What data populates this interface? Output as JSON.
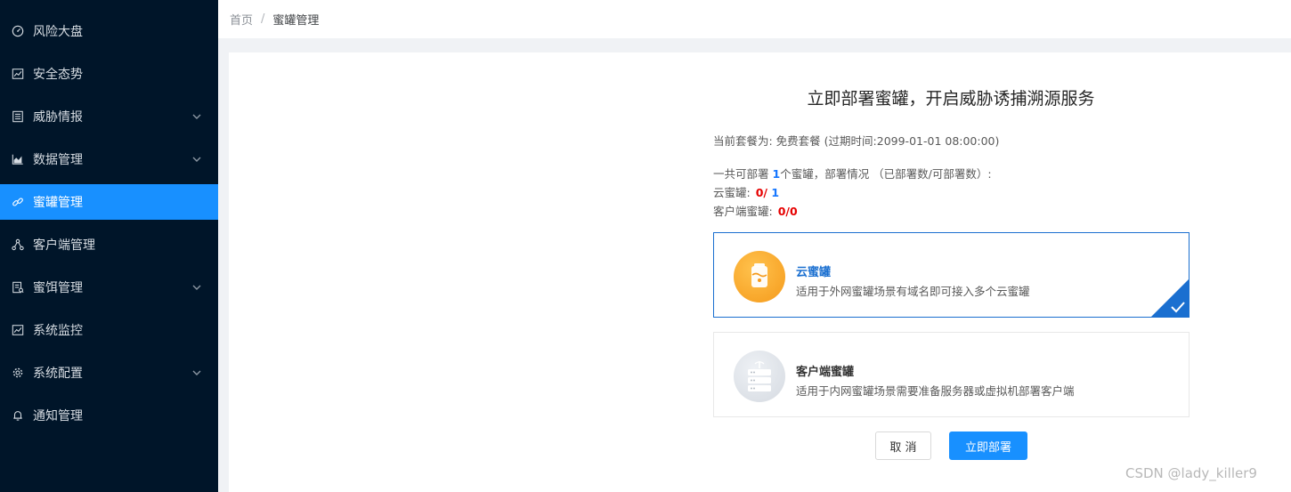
{
  "sidebar": {
    "items": [
      {
        "label": "风险大盘",
        "icon": "dashboard-icon"
      },
      {
        "label": "安全态势",
        "icon": "line-chart-icon"
      },
      {
        "label": "威胁情报",
        "icon": "list-icon",
        "has_submenu": true
      },
      {
        "label": "数据管理",
        "icon": "area-chart-icon",
        "has_submenu": true
      },
      {
        "label": "蜜罐管理",
        "icon": "link-icon",
        "active": true
      },
      {
        "label": "客户端管理",
        "icon": "nodes-icon"
      },
      {
        "label": "蜜饵管理",
        "icon": "file-list-icon",
        "has_submenu": true
      },
      {
        "label": "系统监控",
        "icon": "line-chart-icon"
      },
      {
        "label": "系统配置",
        "icon": "gear-icon",
        "has_submenu": true
      },
      {
        "label": "通知管理",
        "icon": "bell-icon"
      }
    ]
  },
  "breadcrumb": {
    "home": "首页",
    "separator": "/",
    "current": "蜜罐管理"
  },
  "main": {
    "title": "立即部署蜜罐，开启威胁诱捕溯源服务",
    "plan": "当前套餐为: 免费套餐 (过期时间:2099-01-01 08:00:00)",
    "deploy_prefix": "一共可部署 ",
    "deploy_count": "1",
    "deploy_suffix": "个蜜罐，部署情况 （已部署数/可部署数）:",
    "cloud_label": "云蜜罐:",
    "cloud_deployed": "0",
    "cloud_sep": "/ ",
    "cloud_total": "1",
    "client_label": "客户端蜜罐:",
    "client_deployed": "0",
    "client_sep": "/",
    "client_total": "0"
  },
  "cards": [
    {
      "title": "云蜜罐",
      "desc": "适用于外网蜜罐场景有域名即可接入多个云蜜罐",
      "selected": true,
      "icon": "cloud-honeypot-icon"
    },
    {
      "title": "客户端蜜罐",
      "desc": "适用于内网蜜罐场景需要准备服务器或虚拟机部署客户端",
      "selected": false,
      "icon": "server-icon"
    }
  ],
  "buttons": {
    "cancel": "取 消",
    "deploy": "立即部署"
  },
  "watermark": "CSDN @lady_killer9",
  "colors": {
    "sidebar_bg": "#001529",
    "accent": "#1890ff",
    "selected_border": "#1a6fd0",
    "count_red": "#e60000"
  }
}
